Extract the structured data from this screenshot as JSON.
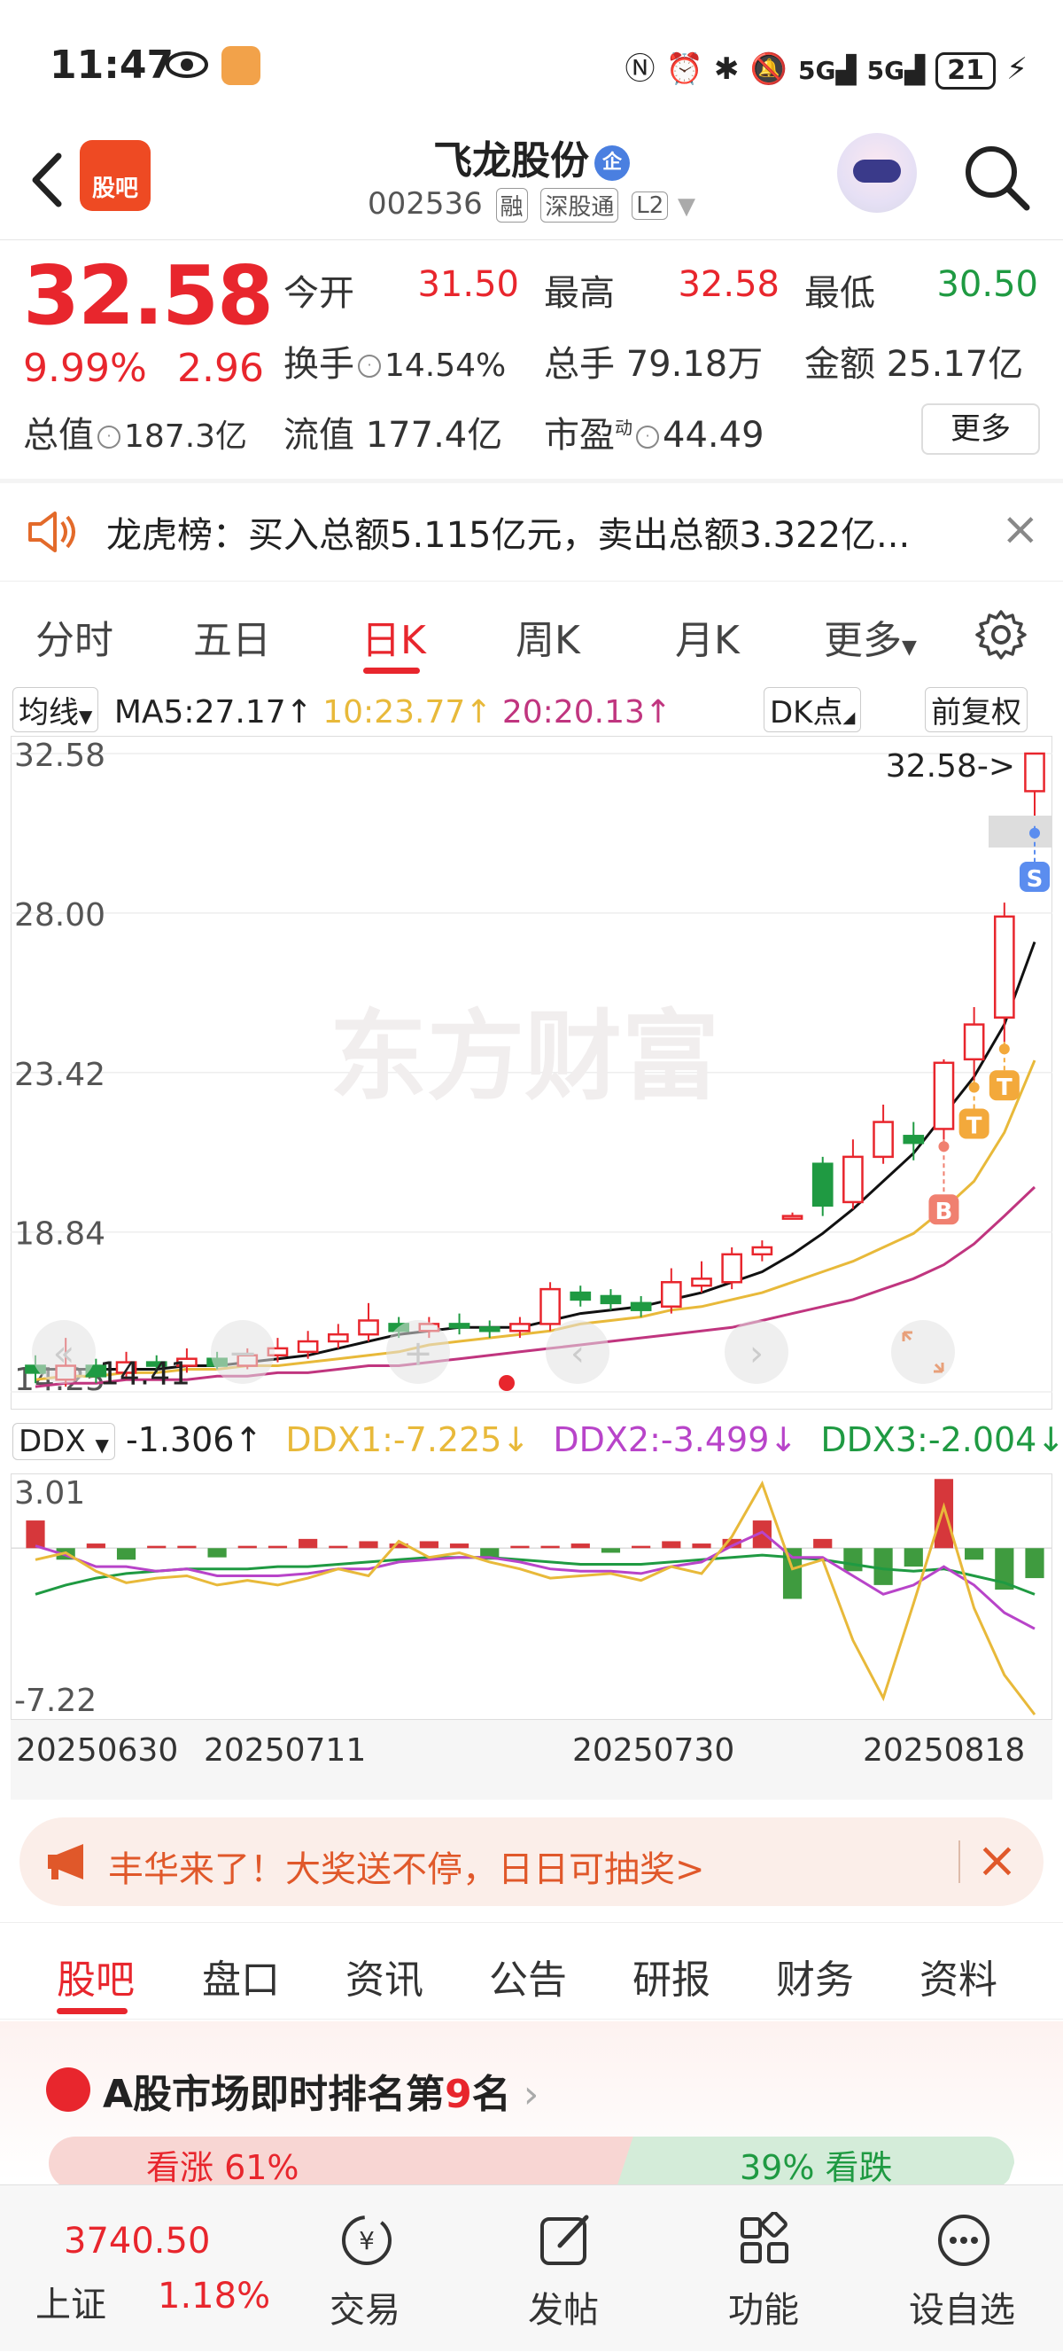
{
  "status_bar": {
    "time": "11:47",
    "battery": "21",
    "network": "5G"
  },
  "header": {
    "app_logo": "股吧",
    "stock_name": "飞龙股份",
    "qi_badge": "企",
    "stock_code": "002536",
    "tags": [
      "融",
      "深股通",
      "L2"
    ]
  },
  "quote": {
    "price": "32.58",
    "change_pct": "9.99%",
    "change_amt": "2.96",
    "open_label": "今开",
    "open": "31.50",
    "high_label": "最高",
    "high": "32.58",
    "low_label": "最低",
    "low": "30.50",
    "turnover_label": "换手",
    "turnover": "14.54%",
    "volume_label": "总手",
    "volume": "79.18万",
    "amount_label": "金额",
    "amount": "25.17亿",
    "mktcap_label": "总值",
    "mktcap": "187.3亿",
    "float_label": "流值",
    "float": "177.4亿",
    "pe_label": "市盈",
    "pe_sup": "动",
    "pe": "44.49",
    "more": "更多"
  },
  "announcement": {
    "text": "龙虎榜：买入总额5.115亿元，卖出总额3.322亿..."
  },
  "chart_tabs": {
    "items": [
      "分时",
      "五日",
      "日K",
      "周K",
      "月K",
      "更多"
    ],
    "active": "日K"
  },
  "ma_row": {
    "selector": "均线",
    "ma5": "MA5:27.17↑",
    "ma10": "10:23.77↑",
    "ma20": "20:20.13↑",
    "dk": "DK点",
    "adjust": "前复权"
  },
  "ddx_row": {
    "selector": "DDX",
    "ddx": "-1.306↑",
    "ddx1": "DDX1:-7.225↓",
    "ddx2": "DDX2:-3.499↓",
    "ddx3": "DDX3:-2.004↓"
  },
  "chart_data": [
    {
      "type": "candlestick",
      "title": "",
      "watermark": "东方财富",
      "y_ticks": [
        "32.58",
        "28.00",
        "23.42",
        "18.84",
        "14.25"
      ],
      "ylim": [
        14.25,
        32.58
      ],
      "price_label": "32.58->",
      "min_label": "14.41",
      "x_ticks": [
        "20250630",
        "20250711",
        "20250730",
        "20250818"
      ],
      "candles": [
        {
          "o": 15.0,
          "c": 14.8,
          "h": 15.3,
          "l": 14.5
        },
        {
          "o": 14.6,
          "c": 15.0,
          "h": 15.8,
          "l": 14.4
        },
        {
          "o": 15.0,
          "c": 14.7,
          "h": 15.2,
          "l": 14.5
        },
        {
          "o": 14.8,
          "c": 15.1,
          "h": 15.4,
          "l": 14.6
        },
        {
          "o": 15.1,
          "c": 15.0,
          "h": 15.3,
          "l": 14.8
        },
        {
          "o": 15.0,
          "c": 15.2,
          "h": 15.5,
          "l": 14.8
        },
        {
          "o": 15.2,
          "c": 15.0,
          "h": 15.4,
          "l": 14.9
        },
        {
          "o": 15.0,
          "c": 15.3,
          "h": 15.5,
          "l": 14.9
        },
        {
          "o": 15.3,
          "c": 15.5,
          "h": 15.8,
          "l": 15.1
        },
        {
          "o": 15.4,
          "c": 15.7,
          "h": 16.0,
          "l": 15.2
        },
        {
          "o": 15.7,
          "c": 15.9,
          "h": 16.2,
          "l": 15.5
        },
        {
          "o": 15.9,
          "c": 16.3,
          "h": 16.8,
          "l": 15.7
        },
        {
          "o": 16.2,
          "c": 16.0,
          "h": 16.4,
          "l": 15.8
        },
        {
          "o": 16.0,
          "c": 16.2,
          "h": 16.4,
          "l": 15.8
        },
        {
          "o": 16.2,
          "c": 16.1,
          "h": 16.5,
          "l": 15.9
        },
        {
          "o": 16.1,
          "c": 16.0,
          "h": 16.3,
          "l": 15.8
        },
        {
          "o": 16.0,
          "c": 16.2,
          "h": 16.4,
          "l": 15.8
        },
        {
          "o": 16.2,
          "c": 17.2,
          "h": 17.4,
          "l": 16.0
        },
        {
          "o": 17.1,
          "c": 16.9,
          "h": 17.3,
          "l": 16.7
        },
        {
          "o": 17.0,
          "c": 16.8,
          "h": 17.2,
          "l": 16.6
        },
        {
          "o": 16.8,
          "c": 16.6,
          "h": 17.0,
          "l": 16.4
        },
        {
          "o": 16.7,
          "c": 17.4,
          "h": 17.8,
          "l": 16.5
        },
        {
          "o": 17.3,
          "c": 17.5,
          "h": 18.0,
          "l": 17.1
        },
        {
          "o": 17.4,
          "c": 18.2,
          "h": 18.4,
          "l": 17.2
        },
        {
          "o": 18.2,
          "c": 18.4,
          "h": 18.6,
          "l": 18.0
        },
        {
          "o": 19.3,
          "c": 19.3,
          "h": 19.4,
          "l": 19.2
        },
        {
          "o": 20.8,
          "c": 19.6,
          "h": 21.0,
          "l": 19.3
        },
        {
          "o": 19.7,
          "c": 21.0,
          "h": 21.5,
          "l": 19.5
        },
        {
          "o": 21.0,
          "c": 22.0,
          "h": 22.5,
          "l": 20.8
        },
        {
          "o": 21.6,
          "c": 21.4,
          "h": 22.0,
          "l": 20.9
        },
        {
          "o": 21.8,
          "c": 23.7,
          "h": 23.8,
          "l": 21.5
        },
        {
          "o": 23.8,
          "c": 24.8,
          "h": 25.3,
          "l": 23.2
        },
        {
          "o": 25.0,
          "c": 27.9,
          "h": 28.3,
          "l": 24.3
        },
        {
          "o": 31.5,
          "c": 32.58,
          "h": 32.58,
          "l": 30.5
        }
      ],
      "ma5": [
        14.9,
        14.9,
        14.9,
        14.9,
        14.9,
        15.0,
        15.0,
        15.1,
        15.2,
        15.3,
        15.5,
        15.7,
        15.9,
        16.0,
        16.1,
        16.1,
        16.1,
        16.3,
        16.5,
        16.6,
        16.7,
        16.9,
        17.1,
        17.4,
        17.7,
        18.2,
        18.8,
        19.5,
        20.3,
        21.1,
        22.2,
        23.3,
        24.8,
        27.17
      ],
      "ma10": [
        14.6,
        14.7,
        14.7,
        14.8,
        14.8,
        14.9,
        14.9,
        15.0,
        15.0,
        15.1,
        15.2,
        15.3,
        15.4,
        15.6,
        15.7,
        15.8,
        15.9,
        16.0,
        16.2,
        16.3,
        16.4,
        16.6,
        16.7,
        16.9,
        17.1,
        17.4,
        17.7,
        18.0,
        18.4,
        18.8,
        19.5,
        20.3,
        21.7,
        23.77
      ],
      "ma20": [
        14.4,
        14.5,
        14.5,
        14.6,
        14.6,
        14.6,
        14.7,
        14.7,
        14.8,
        14.8,
        14.9,
        15.0,
        15.0,
        15.1,
        15.2,
        15.3,
        15.4,
        15.5,
        15.6,
        15.7,
        15.8,
        15.9,
        16.0,
        16.1,
        16.3,
        16.5,
        16.7,
        16.9,
        17.2,
        17.5,
        17.9,
        18.5,
        19.3,
        20.13
      ],
      "signals": [
        {
          "label": "B",
          "candle": 31
        },
        {
          "label": "T",
          "candle": 32
        },
        {
          "label": "T",
          "candle": 33
        },
        {
          "label": "S",
          "candle": 34
        }
      ]
    },
    {
      "type": "bar+line",
      "y_ticks": [
        "3.01",
        "-7.22"
      ],
      "ylim": [
        -7.22,
        3.01
      ],
      "bars": [
        1.2,
        -0.5,
        0.2,
        -0.5,
        0.1,
        0.1,
        -0.4,
        0.1,
        0.1,
        0.4,
        0.1,
        0.3,
        0.2,
        0.3,
        0.2,
        -0.5,
        0.1,
        0.1,
        0.2,
        -0.2,
        0.1,
        0.3,
        0.2,
        0.4,
        1.2,
        -2.2,
        0.4,
        -1.0,
        -1.6,
        -0.8,
        3.0,
        -0.5,
        -1.8,
        -1.3
      ],
      "ddx1": [
        -0.5,
        -0.2,
        -1.0,
        -1.5,
        -1.3,
        -1.2,
        -1.6,
        -1.4,
        -1.6,
        -1.3,
        -0.9,
        -1.2,
        0.3,
        -0.4,
        -0.2,
        -0.6,
        -0.9,
        -1.3,
        -1.2,
        -1.1,
        -1.4,
        -0.8,
        -1.1,
        0.5,
        2.8,
        -0.9,
        -0.5,
        -4.0,
        -6.5,
        -2.4,
        1.8,
        -2.6,
        -5.5,
        -7.225
      ],
      "ddx2": [
        0.1,
        -0.3,
        -0.8,
        -0.8,
        -1.0,
        -0.9,
        -1.2,
        -1.2,
        -1.2,
        -1.1,
        -0.9,
        -0.9,
        -0.6,
        -0.5,
        -0.4,
        -0.4,
        -0.6,
        -0.9,
        -1.0,
        -1.0,
        -1.1,
        -0.8,
        -0.6,
        0.1,
        0.7,
        -0.4,
        -0.4,
        -1.2,
        -2.0,
        -1.6,
        -0.8,
        -1.6,
        -2.8,
        -3.499
      ],
      "ddx3": [
        -2.0,
        -1.6,
        -1.3,
        -1.1,
        -1.0,
        -0.9,
        -0.9,
        -0.9,
        -0.8,
        -0.8,
        -0.7,
        -0.6,
        -0.5,
        -0.4,
        -0.4,
        -0.4,
        -0.5,
        -0.6,
        -0.7,
        -0.7,
        -0.7,
        -0.6,
        -0.5,
        -0.4,
        -0.3,
        -0.4,
        -0.5,
        -0.7,
        -0.9,
        -1.0,
        -0.9,
        -1.2,
        -1.5,
        -2.004
      ]
    }
  ],
  "promo": {
    "text": "丰华来了！大奖送不停，日日可抽奖>"
  },
  "content_tabs": {
    "items": [
      "股吧",
      "盘口",
      "资讯",
      "公告",
      "研报",
      "财务",
      "资料"
    ],
    "active": "股吧"
  },
  "ranking": {
    "prefix": "A股市场即时排名第",
    "rank": "9",
    "suffix": "名",
    "rise_label": "看涨 61%",
    "fall_label": "39% 看跌"
  },
  "bottom_nav": {
    "index_value": "3740.50",
    "index_name": "上证",
    "index_pct": "1.18%",
    "items": [
      "交易",
      "发帖",
      "功能",
      "设自选"
    ]
  },
  "colors": {
    "up": "#e8262d",
    "down": "#1f9a42",
    "ma5": "#111111",
    "ma10": "#e8b93a",
    "ma20": "#c0357f"
  }
}
